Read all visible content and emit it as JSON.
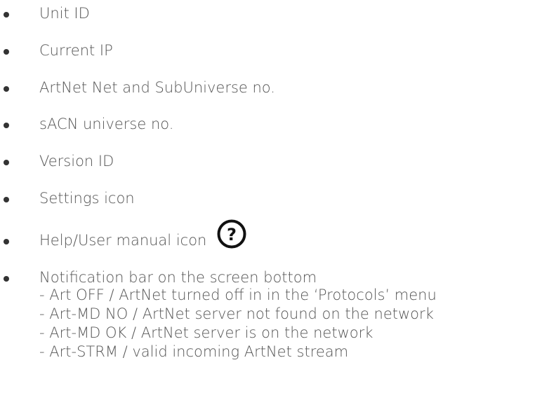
{
  "items": [
    {
      "label": "Unit ID"
    },
    {
      "label": "Current IP"
    },
    {
      "label": "ArtNet Net and SubUniverse no."
    },
    {
      "label": "sACN universe no."
    },
    {
      "label": "Version ID"
    },
    {
      "label": "Settings icon"
    },
    {
      "label": "Help/User manual icon",
      "icon": "question-circle-icon",
      "icon_glyph": "?"
    },
    {
      "label": "Notification bar on the screen bottom",
      "sub_items": [
        "- Art OFF / ArtNet turned off in in the ‘Protocols’ menu",
        "- Art-MD NO / ArtNet server not found on the network",
        "- Art-MD OK / ArtNet server is on the network",
        "- Art-STRM / valid incoming ArtNet stream"
      ]
    }
  ],
  "colors": {
    "text": "#555555",
    "bullet": "#333333",
    "icon": "#111111"
  }
}
